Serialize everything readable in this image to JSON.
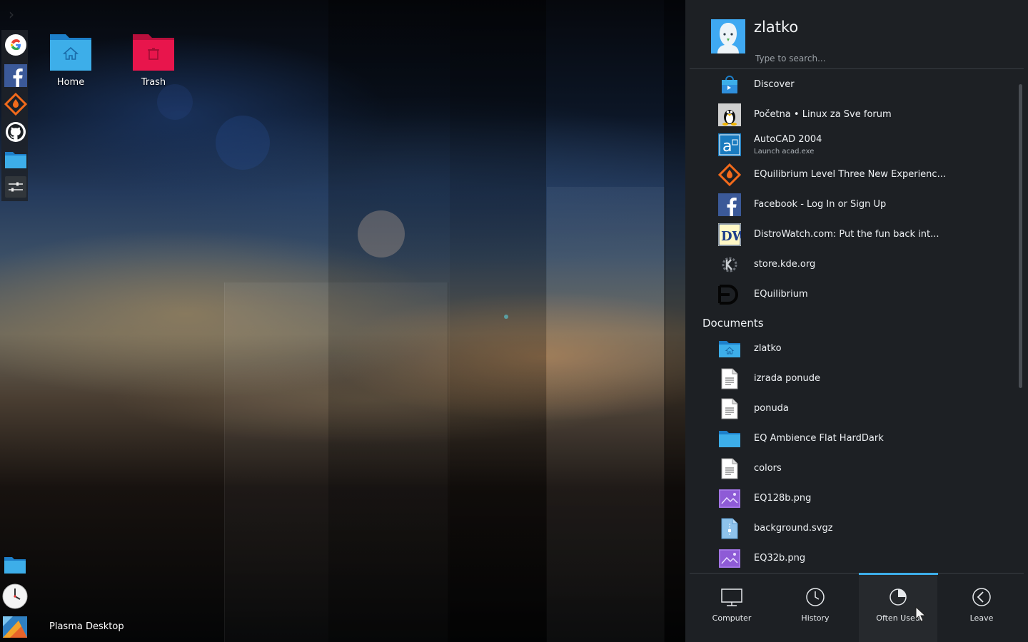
{
  "colors": {
    "accent": "#3daee9",
    "launcher_bg": "#1d2024",
    "folder_blue": "#3daee9",
    "trash_red": "#e8154c"
  },
  "desktop": {
    "icons": [
      {
        "label": "Home",
        "icon": "home-folder-icon"
      },
      {
        "label": "Trash",
        "icon": "trash-folder-icon"
      }
    ]
  },
  "panel": {
    "left_icons": [
      "google-icon",
      "facebook-icon",
      "equilibrium-icon",
      "github-icon",
      "folder-icon",
      "settings-sliders-icon"
    ],
    "bottom_icons": [
      "files-folder-icon",
      "clock-icon",
      "plasma-icon"
    ],
    "task_label": "Plasma Desktop"
  },
  "launcher": {
    "username": "zlatko",
    "search_placeholder": "Type to search...",
    "apps": [
      {
        "title": "Discover",
        "icon": "discover-icon"
      },
      {
        "title": "Početna • Linux za Sve forum",
        "icon": "tux-icon"
      },
      {
        "title": "AutoCAD 2004",
        "subtitle": "Launch acad.exe",
        "icon": "autocad-icon"
      },
      {
        "title": "EQuilibrium Level Three New Experienc...",
        "icon": "equilibrium-diamond-icon"
      },
      {
        "title": "Facebook - Log In or Sign Up",
        "icon": "facebook-icon"
      },
      {
        "title": "DistroWatch.com: Put the fun back int...",
        "icon": "distrowatch-icon"
      },
      {
        "title": "store.kde.org",
        "icon": "kde-store-icon"
      },
      {
        "title": "EQuilibrium",
        "icon": "equilibrium-logo-icon"
      }
    ],
    "documents_heading": "Documents",
    "documents": [
      {
        "title": "zlatko",
        "icon": "home-folder-icon"
      },
      {
        "title": "izrada ponude",
        "icon": "text-document-icon"
      },
      {
        "title": "ponuda",
        "icon": "text-document-icon"
      },
      {
        "title": "EQ Ambience Flat HardDark",
        "icon": "folder-icon"
      },
      {
        "title": "colors",
        "icon": "text-document-icon"
      },
      {
        "title": "EQ128b.png",
        "icon": "image-icon"
      },
      {
        "title": "background.svgz",
        "icon": "svg-document-icon"
      },
      {
        "title": "EQ32b.png",
        "icon": "image-icon"
      }
    ],
    "tabs": [
      {
        "label": "Computer",
        "icon": "computer-icon",
        "active": false
      },
      {
        "label": "History",
        "icon": "history-icon",
        "active": false
      },
      {
        "label": "Often Used",
        "icon": "often-used-icon",
        "active": true
      },
      {
        "label": "Leave",
        "icon": "leave-icon",
        "active": false
      }
    ]
  }
}
